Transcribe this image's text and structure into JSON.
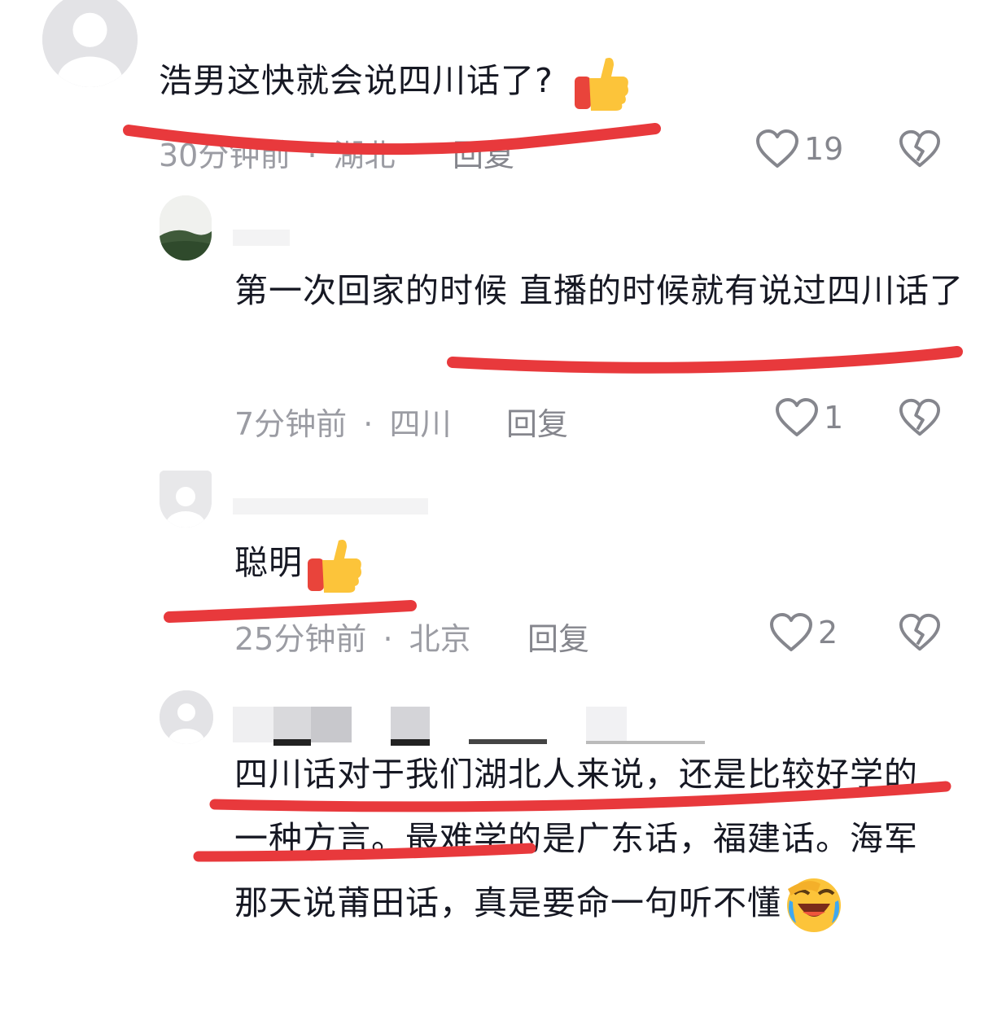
{
  "comments": [
    {
      "text": "浩男这快就会说四川话了?",
      "emoji": "thumbs-up-icon",
      "time": "30分钟前",
      "location": "湖北",
      "reply_label": "回复",
      "likes": "19"
    },
    {
      "text": "第一次回家的时候 直播的时候就有说过四川话了",
      "time": "7分钟前",
      "location": "四川",
      "reply_label": "回复",
      "likes": "1"
    },
    {
      "text": "聪明",
      "emoji": "thumbs-up-icon",
      "time": "25分钟前",
      "location": "北京",
      "reply_label": "回复",
      "likes": "2"
    },
    {
      "text": "四川话对于我们湖北人来说，还是比较好学的一种方言。最难学的是广东话，福建话。海军那天说莆田话，真是要命一句听不懂",
      "emoji": "laughing-crying-icon"
    }
  ],
  "separator": "·",
  "colors": {
    "annotation_red": "#e8393c",
    "meta_gray": "#9b9ca3",
    "text": "#161823"
  }
}
